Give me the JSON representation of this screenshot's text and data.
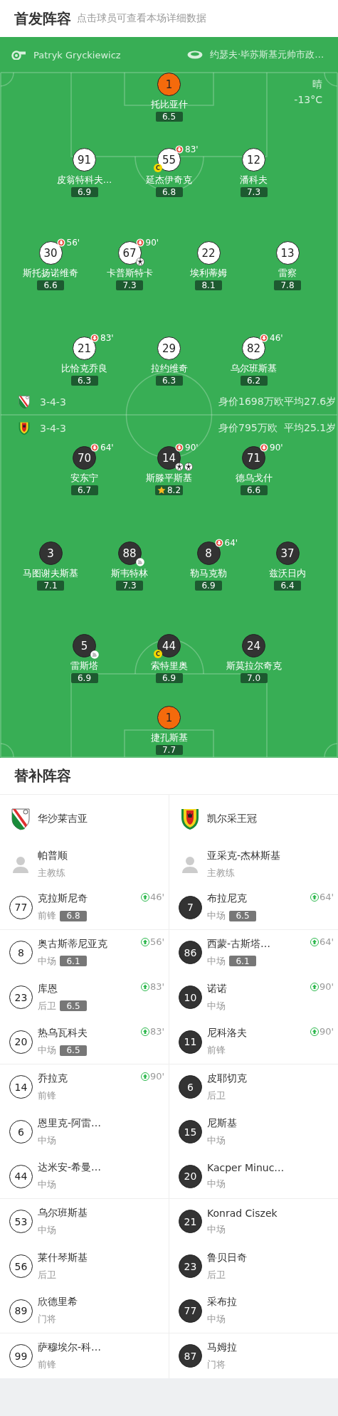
{
  "header": {
    "title": "首发阵容",
    "subtitle": "点击球员可查看本场详细数据"
  },
  "match_info": {
    "referee": "Patryk Gryckiewicz",
    "stadium": "约瑟夫·毕苏斯基元帅市政…",
    "weather": "晴",
    "temperature": "-13°C"
  },
  "home": {
    "kind": "home",
    "formation": "3-4-3",
    "value": "身价1698万欧",
    "age": "平均27.6岁",
    "lines": [
      {
        "players": [
          {
            "number": "1",
            "name": "托比亚什",
            "rating": "6.5",
            "kind": "goalkeeper",
            "best": false
          }
        ]
      },
      {
        "players": [
          {
            "number": "91",
            "name": "皮翁特科夫…",
            "rating": "6.9",
            "kind": "outfield",
            "best": false
          },
          {
            "number": "55",
            "name": "延杰伊奇克",
            "rating": "6.8",
            "kind": "outfield",
            "best": false,
            "captain_badge": "C",
            "sub_off": "83'"
          },
          {
            "number": "12",
            "name": "潘科夫",
            "rating": "7.3",
            "kind": "outfield",
            "best": false
          }
        ]
      },
      {
        "players": [
          {
            "number": "30",
            "name": "斯托扬诺维奇",
            "rating": "6.6",
            "kind": "outfield",
            "best": false,
            "sub_off": "56'"
          },
          {
            "number": "67",
            "name": "卡普斯特卡",
            "rating": "7.3",
            "kind": "outfield",
            "best": false,
            "sub_off": "90'",
            "events": [
              {
                "kind": "goal"
              }
            ]
          },
          {
            "number": "22",
            "name": "埃利蒂姆",
            "rating": "8.1",
            "kind": "outfield",
            "best": false
          },
          {
            "number": "13",
            "name": "雷察",
            "rating": "7.8",
            "kind": "outfield",
            "best": false
          }
        ]
      },
      {
        "players": [
          {
            "number": "21",
            "name": "比恰克乔良",
            "rating": "6.3",
            "kind": "outfield",
            "best": false,
            "sub_off": "83'"
          },
          {
            "number": "29",
            "name": "拉约维奇",
            "rating": "6.3",
            "kind": "outfield",
            "best": false
          },
          {
            "number": "82",
            "name": "乌尔班斯基",
            "rating": "6.2",
            "kind": "outfield",
            "best": false,
            "sub_off": "46'"
          }
        ]
      }
    ]
  },
  "away": {
    "kind": "away",
    "formation": "3-4-3",
    "value": "身价795万欧",
    "age": "平均25.1岁",
    "lines": [
      {
        "players": [
          {
            "number": "70",
            "name": "安东宁",
            "rating": "6.7",
            "kind": "outfield",
            "best": false,
            "sub_off": "64'"
          },
          {
            "number": "14",
            "name": "斯滕平斯基",
            "rating": "8.2",
            "kind": "outfield",
            "best": true,
            "sub_off": "90'",
            "events": [
              {
                "kind": "goal"
              },
              {
                "kind": "goal"
              }
            ]
          },
          {
            "number": "71",
            "name": "德乌戈什",
            "rating": "6.6",
            "kind": "outfield",
            "best": false,
            "sub_off": "90'"
          }
        ]
      },
      {
        "players": [
          {
            "number": "3",
            "name": "马图谢夫斯基",
            "rating": "7.1",
            "kind": "outfield",
            "best": false
          },
          {
            "number": "88",
            "name": "斯韦特林",
            "rating": "7.3",
            "kind": "outfield",
            "best": false,
            "events": [
              {
                "kind": "assist"
              }
            ]
          },
          {
            "number": "8",
            "name": "勒马克勒",
            "rating": "6.9",
            "kind": "outfield",
            "best": false,
            "sub_off": "64'"
          },
          {
            "number": "37",
            "name": "兹沃日内",
            "rating": "6.4",
            "kind": "outfield",
            "best": false
          }
        ]
      },
      {
        "players": [
          {
            "number": "5",
            "name": "雷斯塔",
            "rating": "6.9",
            "kind": "outfield",
            "best": false,
            "events": [
              {
                "kind": "assist"
              }
            ]
          },
          {
            "number": "44",
            "name": "索特里奥",
            "rating": "6.9",
            "kind": "outfield",
            "best": false,
            "captain_badge": "C"
          },
          {
            "number": "24",
            "name": "斯莫拉尔奇克",
            "rating": "7.0",
            "kind": "outfield",
            "best": false
          }
        ]
      },
      {
        "players": [
          {
            "number": "1",
            "name": "捷孔斯基",
            "rating": "7.7",
            "kind": "goalkeeper",
            "best": false
          }
        ]
      }
    ]
  },
  "substitutes": {
    "title": "替补阵容",
    "teams": [
      {
        "kind": "home",
        "name": "华沙莱吉亚",
        "coach": {
          "name": "帕普顺",
          "role": "主教练"
        },
        "players": [
          {
            "number": "77",
            "name": "克拉斯尼奇",
            "position": "前锋",
            "rating": "6.8",
            "sub_on": "46'"
          },
          {
            "number": "8",
            "name": "奥古斯蒂尼亚克",
            "position": "中场",
            "rating": "6.1",
            "sub_on": "56'"
          },
          {
            "number": "23",
            "name": "库恩",
            "position": "后卫",
            "rating": "6.5",
            "sub_on": "83'"
          },
          {
            "number": "20",
            "name": "热乌瓦科夫",
            "position": "中场",
            "rating": "6.5",
            "sub_on": "83'"
          },
          {
            "number": "14",
            "name": "乔拉克",
            "position": "前锋",
            "sub_on": "90'"
          },
          {
            "number": "6",
            "name": "恩里克-阿雷…",
            "position": "中场"
          },
          {
            "number": "44",
            "name": "达米安-希曼…",
            "position": "中场"
          },
          {
            "number": "53",
            "name": "乌尔班斯基",
            "position": "中场"
          },
          {
            "number": "56",
            "name": "莱什琴斯基",
            "position": "后卫"
          },
          {
            "number": "89",
            "name": "欣德里希",
            "position": "门将"
          },
          {
            "number": "99",
            "name": "萨穆埃尔-科…",
            "position": "前锋"
          }
        ]
      },
      {
        "kind": "away",
        "name": "凯尔采王冠",
        "coach": {
          "name": "亚采克-杰林斯基",
          "role": "主教练"
        },
        "players": [
          {
            "number": "7",
            "name": "布拉尼克",
            "position": "中场",
            "rating": "6.5",
            "sub_on": "64'"
          },
          {
            "number": "86",
            "name": "西蒙-古斯塔…",
            "position": "中场",
            "rating": "6.1",
            "sub_on": "64'"
          },
          {
            "number": "10",
            "name": "诺诺",
            "position": "中场",
            "sub_on": "90'"
          },
          {
            "number": "11",
            "name": "尼科洛夫",
            "position": "前锋",
            "sub_on": "90'"
          },
          {
            "number": "6",
            "name": "皮耶切克",
            "position": "后卫"
          },
          {
            "number": "15",
            "name": "尼斯基",
            "position": "中场"
          },
          {
            "number": "20",
            "name": "Kacper Minuc…",
            "position": "中场"
          },
          {
            "number": "21",
            "name": "Konrad Ciszek",
            "position": "中场"
          },
          {
            "number": "23",
            "name": "鲁贝日奇",
            "position": "后卫"
          },
          {
            "number": "77",
            "name": "采布拉",
            "position": "中场"
          },
          {
            "number": "87",
            "name": "马姆拉",
            "position": "门将"
          }
        ]
      }
    ]
  }
}
